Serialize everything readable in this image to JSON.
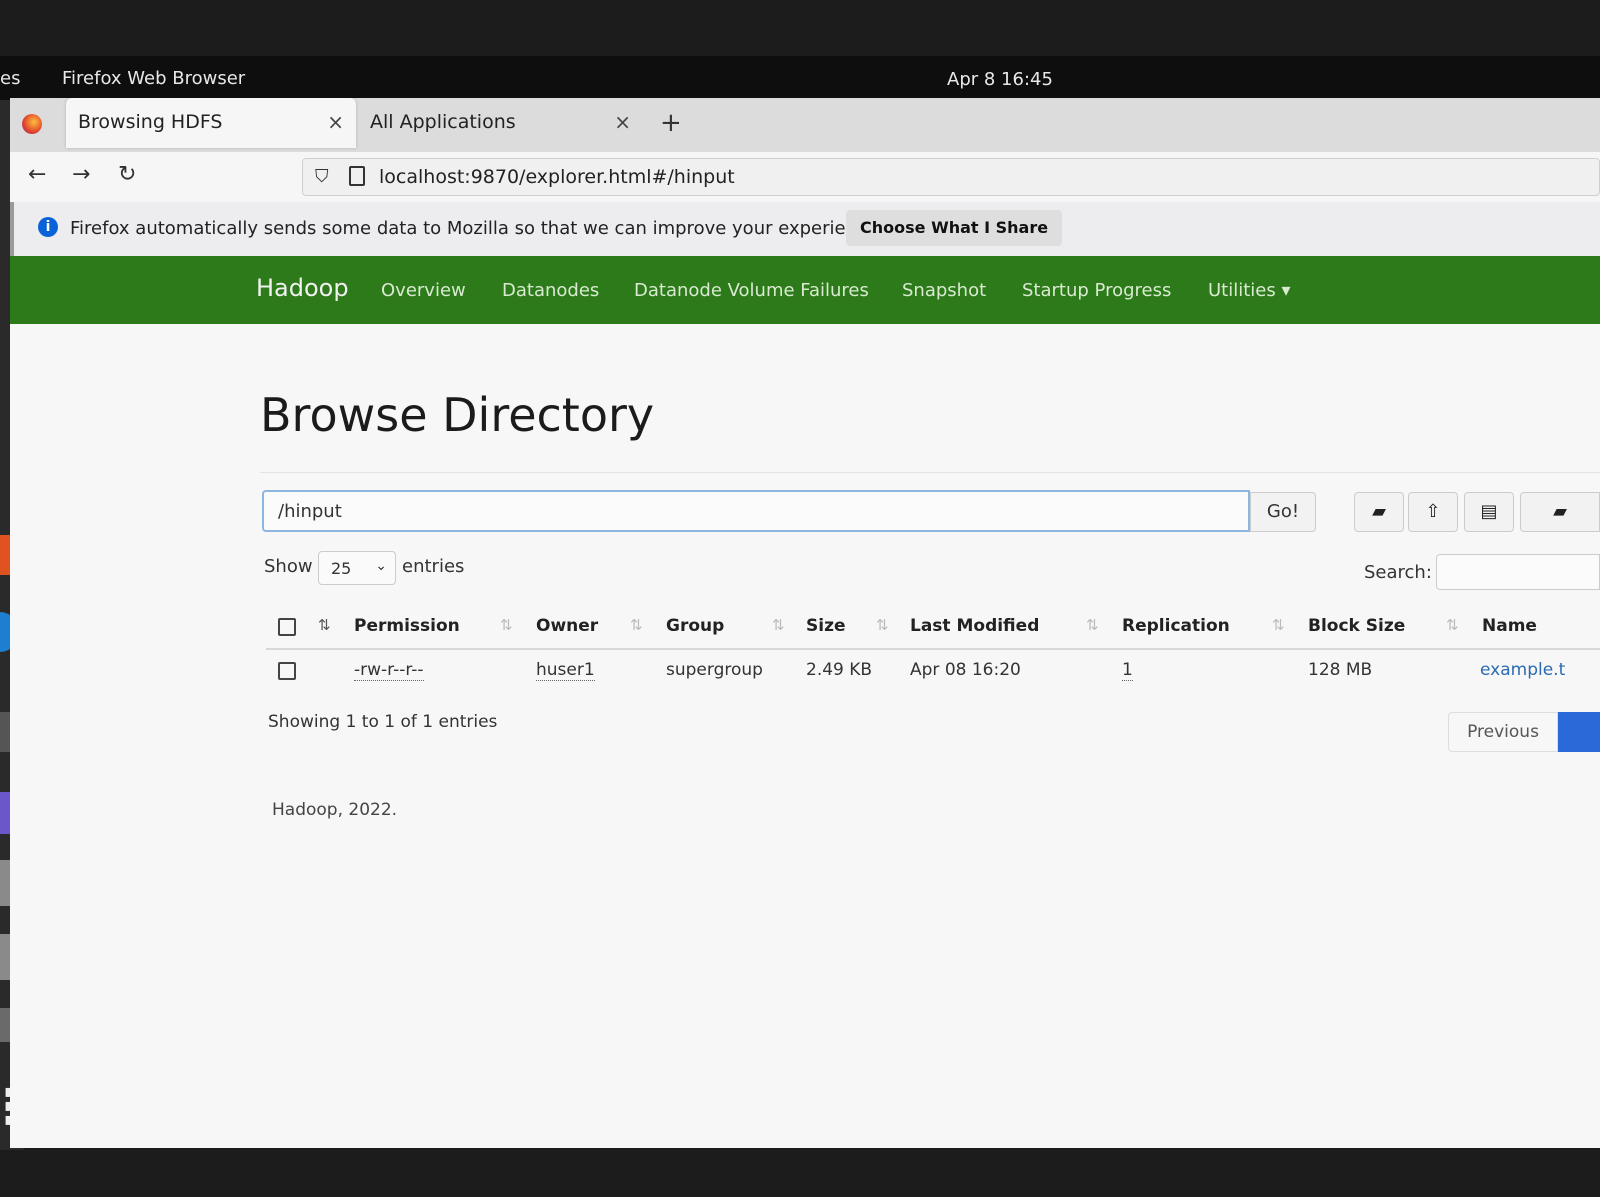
{
  "topbar": {
    "activities": "es",
    "app_name": "Firefox Web Browser",
    "clock": "Apr 8  16:45"
  },
  "tabs": [
    {
      "title": "Browsing HDFS",
      "close": "×"
    },
    {
      "title": "All Applications",
      "close": "×"
    }
  ],
  "new_tab": "+",
  "navbar": {
    "back": "←",
    "forward": "→",
    "reload": "↻",
    "url": "localhost:9870/explorer.html#/hinput"
  },
  "notification": {
    "icon": "i",
    "message": "Firefox automatically sends some data to Mozilla so that we can improve your experience.",
    "button": "Choose What I Share"
  },
  "hadoop_nav": {
    "brand": "Hadoop",
    "links": [
      "Overview",
      "Datanodes",
      "Datanode Volume Failures",
      "Snapshot",
      "Startup Progress",
      "Utilities ▾"
    ]
  },
  "page_title": "Browse Directory",
  "path_input": {
    "value": "/hinput"
  },
  "go_button": "Go!",
  "show_label": "Show",
  "entries_select": "25",
  "entries_label": "entries",
  "search_label": "Search:",
  "table": {
    "headers": [
      "Permission",
      "Owner",
      "Group",
      "Size",
      "Last Modified",
      "Replication",
      "Block Size",
      "Name"
    ],
    "rows": [
      {
        "permission": "-rw-r--r--",
        "owner": "huser1",
        "group": "supergroup",
        "size": "2.49 KB",
        "modified": "Apr 08 16:20",
        "replication": "1",
        "block_size": "128 MB",
        "name": "example.t"
      }
    ]
  },
  "showing_text": "Showing 1 to 1 of 1 entries",
  "pagination": {
    "previous": "Previous"
  },
  "footer": "Hadoop, 2022.",
  "colors": {
    "hadoop_green": "#2c7a1a",
    "link_blue": "#2a6ab2",
    "info_blue": "#0a62d8"
  }
}
